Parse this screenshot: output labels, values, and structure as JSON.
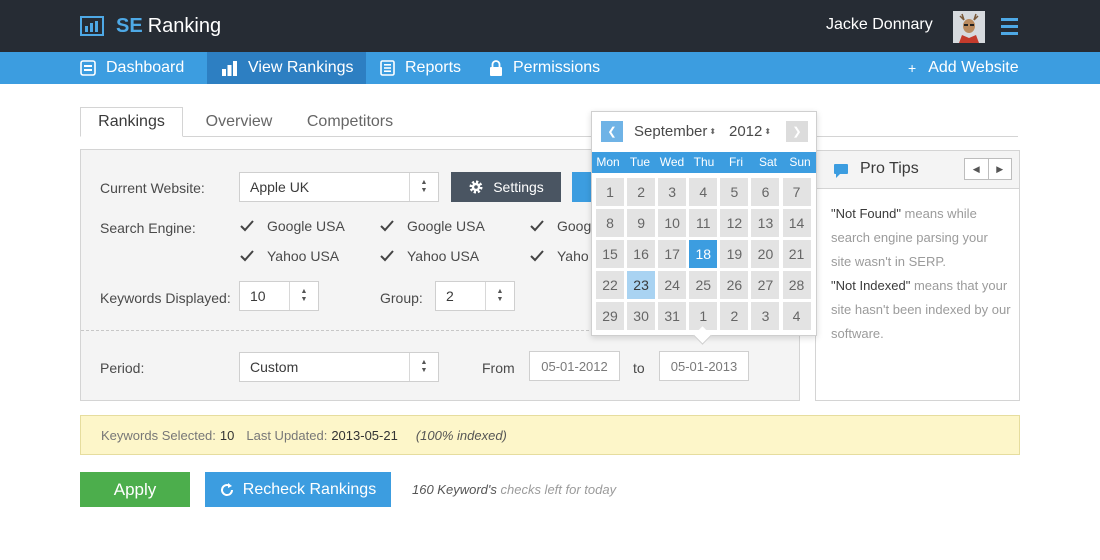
{
  "app": {
    "brand_prefix": "SE",
    "brand_name": "Ranking"
  },
  "user": {
    "name": "Jacke Donnary"
  },
  "nav": {
    "dashboard": "Dashboard",
    "view_rankings": "View Rankings",
    "reports": "Reports",
    "permissions": "Permissions",
    "add_website": "Add Website"
  },
  "tabs": [
    "Rankings",
    "Overview",
    "Competitors"
  ],
  "form": {
    "current_website_label": "Current Website:",
    "current_website_value": "Apple UK",
    "settings_label": "Settings",
    "search_engine_label": "Search Engine:",
    "engines_row1": [
      "Google USA",
      "Google USA",
      "Goog"
    ],
    "engines_row2": [
      "Yahoo USA",
      "Yahoo USA",
      "Yaho"
    ],
    "keywords_displayed_label": "Keywords Displayed:",
    "keywords_displayed_value": "10",
    "group_label": "Group:",
    "group_value": "2",
    "period_label": "Period:",
    "period_value": "Custom",
    "from_label": "From",
    "from_value": "05-01-2012",
    "to_label": "to",
    "to_value": "05-01-2013"
  },
  "calendar": {
    "month": "September",
    "year": "2012",
    "weekdays": [
      "Mon",
      "Tue",
      "Wed",
      "Thu",
      "Fri",
      "Sat",
      "Sun"
    ],
    "weeks": [
      [
        "1",
        "2",
        "3",
        "4",
        "5",
        "6",
        "7"
      ],
      [
        "8",
        "9",
        "10",
        "11",
        "12",
        "13",
        "14"
      ],
      [
        "15",
        "16",
        "17",
        "18",
        "19",
        "20",
        "21"
      ],
      [
        "22",
        "23",
        "24",
        "25",
        "26",
        "27",
        "28"
      ],
      [
        "29",
        "30",
        "31",
        "1",
        "2",
        "3",
        "4"
      ]
    ],
    "selected_day": "18",
    "highlighted_day": "23"
  },
  "pro_tips": {
    "title": "Pro Tips",
    "tip1_key": "\"Not Found\"",
    "tip1_text": " means while search engine parsing your site wasn't in SERP.",
    "tip2_key": "\"Not Indexed\"",
    "tip2_text": " means that your site hasn't been indexed by our software."
  },
  "status": {
    "keywords_selected_label": "Keywords Selected:",
    "keywords_selected_value": "10",
    "last_updated_label": "Last Updated:",
    "last_updated_value": "2013-05-21",
    "indexed_note": "(100% indexed)"
  },
  "actions": {
    "apply": "Apply",
    "recheck": "Recheck Rankings",
    "checks_count": "160 Keyword's",
    "checks_suffix": " checks left for today"
  },
  "colors": {
    "accent": "#3c9de0",
    "topbar": "#262c34",
    "apply": "#4cae4c",
    "status_bg": "#fdf6c9"
  }
}
